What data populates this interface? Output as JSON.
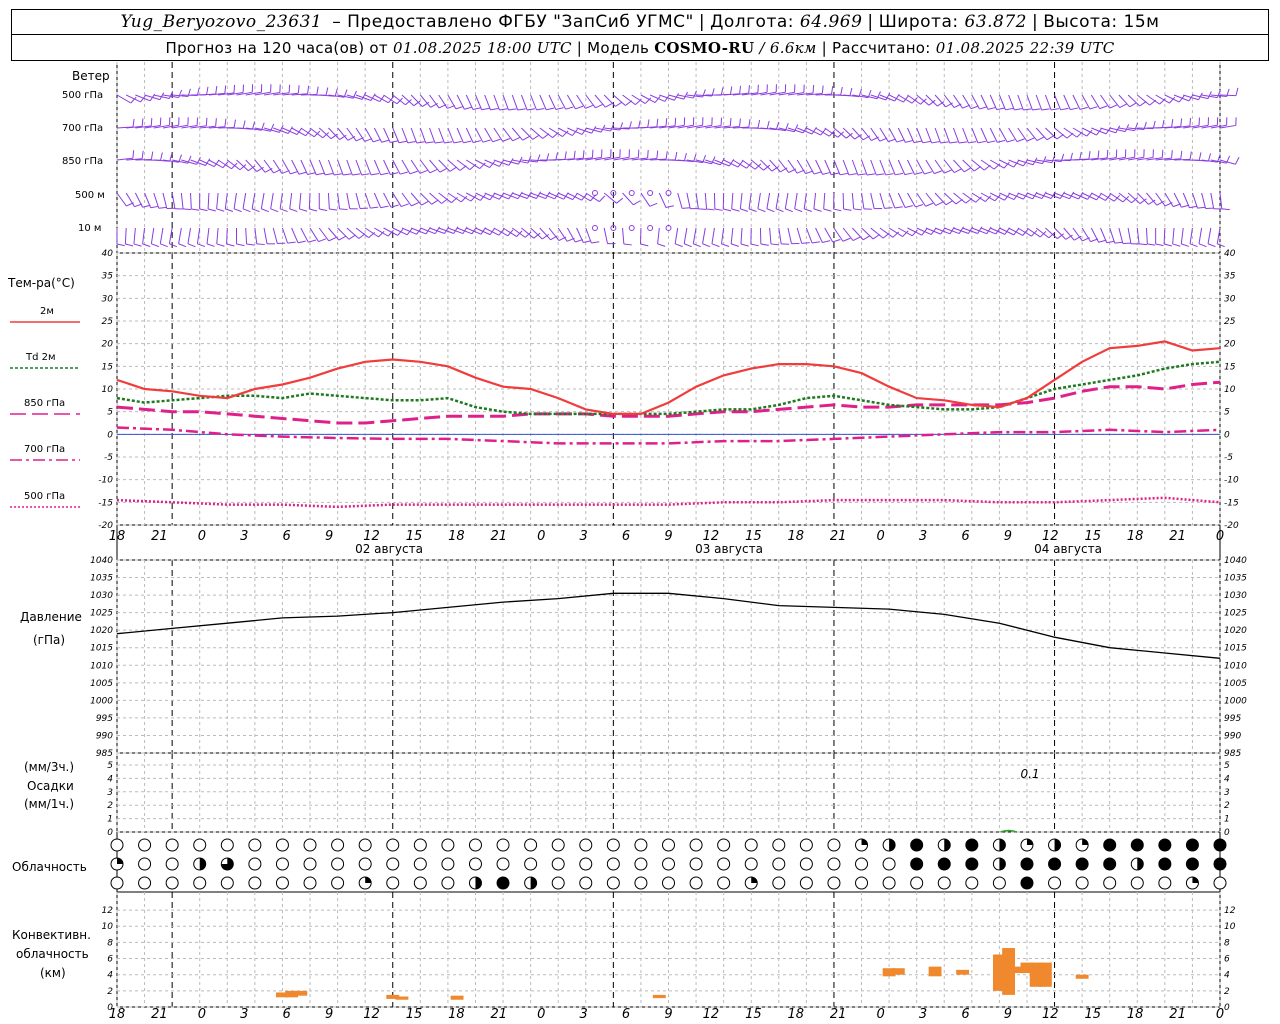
{
  "header": {
    "station": "Yug_Beryozovo_23631",
    "provided_by": "– Предоставлено ФГБУ \"ЗапСиб УГМС\"",
    "lon_label": "Долгота:",
    "lon": "64.969",
    "lat_label": "Широта:",
    "lat": "63.872",
    "alt_label": "Высота:",
    "alt": "15м",
    "forecast_label": "Прогноз на 120 часа(ов) от",
    "forecast_from": "01.08.2025 18:00 UTC",
    "model_label": "Модель",
    "model": "COSMO-RU",
    "model_res": "/ 6.6км",
    "calc_label": "Рассчитано:",
    "calc_time": "01.08.2025 22:39 UTC"
  },
  "panels": {
    "wind": {
      "title": "Ветер",
      "levels": [
        "500 гПа",
        "700 гПа",
        "850 гПа",
        "500 м",
        "10 м"
      ]
    },
    "temp": {
      "title": "Тем-ра(°C)",
      "legend": [
        "2м",
        "Td 2м",
        "850 гПа",
        "700 гПа",
        "500 гПа"
      ],
      "ticks": [
        "40",
        "35",
        "30",
        "25",
        "20",
        "15",
        "10",
        "5",
        "0",
        "-5",
        "-10",
        "-15",
        "-20"
      ]
    },
    "pressure": {
      "title": "Давление",
      "unit": "(гПа)",
      "ticks": [
        "1040",
        "1035",
        "1030",
        "1025",
        "1020",
        "1015",
        "1010",
        "1005",
        "1000",
        "995",
        "990",
        "985"
      ]
    },
    "precip": {
      "title1": "(мм/3ч.)",
      "title2": "Осадки",
      "title3": "(мм/1ч.)",
      "ticks": [
        "5",
        "4",
        "3",
        "2",
        "1",
        "0"
      ],
      "annotation": "0.1"
    },
    "cloud": {
      "title": "Облачность"
    },
    "convective": {
      "title1": "Конвективн.",
      "title2": "облачность",
      "title3": "(км)",
      "ticks": [
        "12",
        "10",
        "8",
        "6",
        "4",
        "2",
        "0"
      ]
    }
  },
  "time_axis": {
    "hour_labels": [
      "18",
      "21",
      "0",
      "3",
      "6",
      "9",
      "12",
      "15",
      "18",
      "21",
      "0",
      "3",
      "6",
      "9",
      "12",
      "15",
      "18",
      "21",
      "0",
      "3",
      "6",
      "9",
      "12",
      "15",
      "18",
      "21",
      "0"
    ],
    "dates": [
      "02 августа",
      "03 августа",
      "04 августа"
    ]
  },
  "colors": {
    "t2m": "#f03c3c",
    "td2m": "#1f7a1f",
    "t850": "#e0208a",
    "t700": "#e0208a",
    "t500": "#e0208a",
    "pressure": "#000000",
    "wind": "#8a3ce0",
    "convective": "#f0882e",
    "precip": "#2aa52a"
  },
  "chart_data": [
    {
      "type": "line",
      "title": "Тем-ра(°C)",
      "x_unit": "hours from 01.08.2025 18:00 UTC",
      "ylim": [
        -20,
        40
      ],
      "series": [
        {
          "name": "2м",
          "x": [
            0,
            3,
            6,
            9,
            12,
            15,
            18,
            21,
            24,
            27,
            30,
            33,
            36,
            39,
            42,
            45,
            48,
            51,
            54,
            57,
            60,
            63,
            66,
            69,
            72,
            75,
            78,
            81,
            84,
            87,
            90,
            93,
            96,
            99,
            102,
            105,
            108,
            111,
            114,
            117,
            120
          ],
          "values": [
            12,
            10,
            9.5,
            8.5,
            8,
            10,
            11,
            12.5,
            14.5,
            16,
            16.5,
            16,
            15,
            12.5,
            10.5,
            10,
            8,
            5.5,
            4.5,
            4.5,
            7,
            10.5,
            13,
            14.5,
            15.5,
            15.5,
            15,
            13.5,
            10.5,
            8,
            7.5,
            6.5,
            6,
            8,
            12,
            16,
            19,
            19.5,
            20.5,
            18.5,
            19
          ]
        },
        {
          "name": "Td 2м",
          "x": [
            0,
            3,
            6,
            9,
            12,
            15,
            18,
            21,
            24,
            27,
            30,
            33,
            36,
            39,
            42,
            45,
            48,
            51,
            54,
            57,
            60,
            63,
            66,
            69,
            72,
            75,
            78,
            81,
            84,
            87,
            90,
            93,
            96,
            99,
            102,
            105,
            108,
            111,
            114,
            117,
            120
          ],
          "values": [
            8,
            7,
            7.5,
            8,
            8.5,
            8.5,
            8,
            9,
            8.5,
            8,
            7.5,
            7.5,
            8,
            6,
            5,
            4.5,
            4.5,
            4.5,
            4.5,
            4.5,
            4.5,
            5,
            5.5,
            5.5,
            6.5,
            8,
            8.5,
            7.5,
            6.5,
            6,
            5.5,
            5.5,
            6,
            8,
            10,
            11,
            12,
            13,
            14.5,
            15.5,
            16
          ]
        },
        {
          "name": "850 гПа",
          "x": [
            0,
            3,
            6,
            9,
            12,
            15,
            18,
            21,
            24,
            27,
            30,
            33,
            36,
            39,
            42,
            45,
            48,
            51,
            54,
            57,
            60,
            63,
            66,
            69,
            72,
            75,
            78,
            81,
            84,
            87,
            90,
            93,
            96,
            99,
            102,
            105,
            108,
            111,
            114,
            117,
            120
          ],
          "values": [
            6,
            5.5,
            5,
            5,
            4.5,
            4,
            3.5,
            3,
            2.5,
            2.5,
            3,
            3.5,
            4,
            4,
            4,
            4.5,
            4.5,
            4.5,
            4,
            4,
            4,
            4.5,
            5,
            5,
            5.5,
            6,
            6.5,
            6,
            6,
            6.5,
            6.5,
            6.5,
            6.5,
            7,
            8,
            9.5,
            10.5,
            10.5,
            10,
            11,
            11.5
          ]
        },
        {
          "name": "700 гПа",
          "x": [
            0,
            6,
            12,
            18,
            24,
            30,
            36,
            42,
            48,
            54,
            60,
            66,
            72,
            78,
            84,
            90,
            96,
            102,
            108,
            114,
            120
          ],
          "values": [
            1.5,
            1,
            0,
            -0.5,
            -0.8,
            -1,
            -1,
            -1.5,
            -2,
            -2,
            -2,
            -1.5,
            -1.5,
            -1,
            -0.5,
            0,
            0.5,
            0.5,
            1,
            0.5,
            1
          ]
        },
        {
          "name": "500 гПа",
          "x": [
            0,
            6,
            12,
            18,
            24,
            30,
            36,
            42,
            48,
            54,
            60,
            66,
            72,
            78,
            84,
            90,
            96,
            102,
            108,
            114,
            120
          ],
          "values": [
            -14.5,
            -15,
            -15.5,
            -15.5,
            -16,
            -15.5,
            -15.5,
            -15.5,
            -15.5,
            -15.5,
            -15.5,
            -15,
            -15,
            -14.5,
            -14.5,
            -14.5,
            -15,
            -15,
            -14.5,
            -14,
            -15
          ]
        }
      ]
    },
    {
      "type": "line",
      "title": "Давление",
      "ylabel": "(гПа)",
      "x_unit": "hours from 01.08.2025 18:00 UTC",
      "ylim": [
        985,
        1040
      ],
      "series": [
        {
          "name": "Давление",
          "x": [
            0,
            6,
            12,
            18,
            24,
            30,
            36,
            42,
            48,
            54,
            60,
            66,
            72,
            78,
            84,
            90,
            96,
            102,
            108,
            114,
            120
          ],
          "values": [
            1019,
            1020.5,
            1022,
            1023.5,
            1024,
            1025,
            1026.5,
            1028,
            1029,
            1030.5,
            1030.5,
            1029,
            1027,
            1026.5,
            1026,
            1024.5,
            1022,
            1018,
            1015,
            1013.5,
            1012
          ]
        }
      ]
    },
    {
      "type": "bar",
      "title": "Конвективн. облачность (км)",
      "x_unit": "hours from 01.08.2025 18:00 UTC",
      "ylim": [
        0,
        13
      ],
      "bars": [
        {
          "x": 18,
          "bottom": 1.2,
          "top": 1.8
        },
        {
          "x": 19,
          "bottom": 1.2,
          "top": 2.0
        },
        {
          "x": 20,
          "bottom": 1.4,
          "top": 2.0
        },
        {
          "x": 30,
          "bottom": 1.0,
          "top": 1.5
        },
        {
          "x": 31,
          "bottom": 0.9,
          "top": 1.3
        },
        {
          "x": 37,
          "bottom": 0.9,
          "top": 1.4
        },
        {
          "x": 59,
          "bottom": 1.1,
          "top": 1.5
        },
        {
          "x": 84,
          "bottom": 3.8,
          "top": 4.8
        },
        {
          "x": 85,
          "bottom": 4.0,
          "top": 4.8
        },
        {
          "x": 89,
          "bottom": 3.8,
          "top": 5.0
        },
        {
          "x": 92,
          "bottom": 4.0,
          "top": 4.6
        },
        {
          "x": 96,
          "bottom": 2.0,
          "top": 6.5
        },
        {
          "x": 97,
          "bottom": 1.5,
          "top": 7.3
        },
        {
          "x": 98,
          "bottom": 4.2,
          "top": 5.0
        },
        {
          "x": 99,
          "bottom": 4.2,
          "top": 5.5
        },
        {
          "x": 100,
          "bottom": 2.5,
          "top": 5.5
        },
        {
          "x": 101,
          "bottom": 2.5,
          "top": 5.5
        },
        {
          "x": 105,
          "bottom": 3.5,
          "top": 4.0
        }
      ]
    },
    {
      "type": "bar",
      "title": "Осадки",
      "x_unit": "hours from 01.08.2025 18:00 UTC",
      "ylim": [
        0,
        5
      ],
      "series": [
        {
          "name": "Осадки",
          "x": [
            97
          ],
          "values": [
            0.1
          ]
        }
      ]
    },
    {
      "type": "table",
      "title": "Облачность",
      "note": "cloud cover per 3h step, 3 layers (top/mid/low), 0..1 fraction (rendered as partially filled circles)",
      "rows": [
        [
          0,
          0,
          0,
          0,
          0,
          0,
          0,
          0,
          0,
          0,
          0,
          0,
          0,
          0,
          0,
          0,
          0,
          0,
          0,
          0,
          0,
          0,
          0,
          0,
          0,
          0,
          0,
          0.25,
          0.5,
          1,
          0.5,
          1,
          0.5,
          0.25,
          0.5,
          0.25,
          1,
          1,
          1,
          1,
          1
        ],
        [
          0.25,
          0,
          0,
          0.5,
          0.75,
          0,
          0,
          0,
          0,
          0,
          0,
          0,
          0,
          0,
          0,
          0,
          0,
          0,
          0,
          0,
          0,
          0,
          0,
          0,
          0,
          0,
          0,
          0,
          0,
          1,
          1,
          1,
          0.5,
          1,
          1,
          1,
          1,
          0.5,
          1,
          1,
          1
        ],
        [
          0,
          0,
          0,
          0,
          0,
          0,
          0,
          0,
          0,
          0.25,
          0,
          0,
          0,
          0.5,
          1,
          0.5,
          0,
          0,
          0,
          0,
          0,
          0,
          0,
          0.25,
          0,
          0,
          0,
          0,
          0,
          0,
          0,
          0,
          0,
          1,
          0,
          0,
          0,
          0,
          0,
          0.25,
          0
        ]
      ]
    }
  ]
}
